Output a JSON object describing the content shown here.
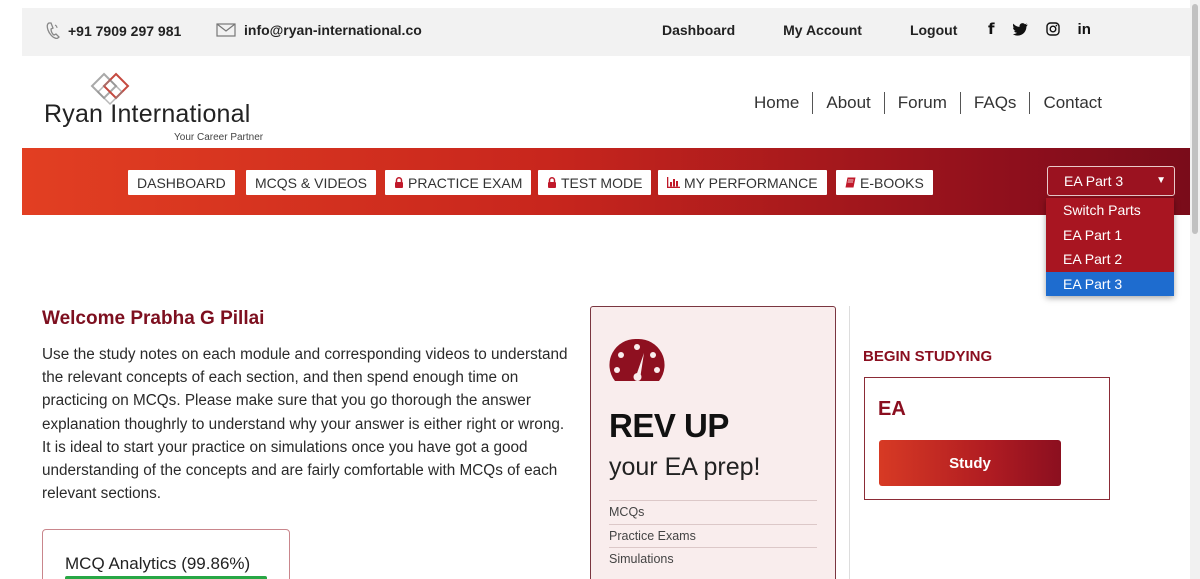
{
  "topbar": {
    "phone": "+91 7909 297 981",
    "email": "info@ryan-international.co",
    "links": [
      "Dashboard",
      "My Account",
      "Logout"
    ],
    "social": [
      "f",
      "t",
      "ig",
      "in"
    ]
  },
  "header": {
    "brand": "Ryan International",
    "tagline": "Your Career Partner",
    "nav": [
      "Home",
      "About",
      "Forum",
      "FAQs",
      "Contact"
    ]
  },
  "toolbar": {
    "buttons": [
      {
        "label": "DASHBOARD",
        "icon": ""
      },
      {
        "label": "MCQS & VIDEOS",
        "icon": ""
      },
      {
        "label": "PRACTICE EXAM",
        "icon": "lock-icon"
      },
      {
        "label": "TEST MODE",
        "icon": "lock-icon"
      },
      {
        "label": "MY PERFORMANCE",
        "icon": "bar-chart-icon"
      },
      {
        "label": "E-BOOKS",
        "icon": "book-icon"
      }
    ],
    "part_select": {
      "selected": "EA Part 3",
      "options": [
        "Switch Parts",
        "EA Part 1",
        "EA Part 2",
        "EA Part 3"
      ]
    }
  },
  "welcome": {
    "title": "Welcome Prabha G Pillai",
    "text": "Use the study notes on each module and corresponding videos to understand the relevant concepts of each section, and then spend enough time on practicing on MCQs. Please make sure that you go thorough the answer explanation thoughrly to understand why your answer is either right or wrong. It is ideal to start your practice on simulations once you have got a good understanding of the concepts and are fairly comfortable with MCQs of each relevant sections."
  },
  "analytics": {
    "label": "MCQ Analytics (99.86%)",
    "progress": 99.86
  },
  "revup": {
    "title": "REV UP",
    "subtitle": "your EA prep!",
    "items": [
      "MCQs",
      "Practice Exams",
      "Simulations"
    ]
  },
  "study": {
    "heading": "BEGIN STUDYING",
    "course": "EA",
    "button": "Study"
  },
  "colors": {
    "brand_red": "#b01c22",
    "dark_red": "#7d0f1f",
    "selected_blue": "#1e6ccf",
    "progress_green": "#28a745"
  }
}
